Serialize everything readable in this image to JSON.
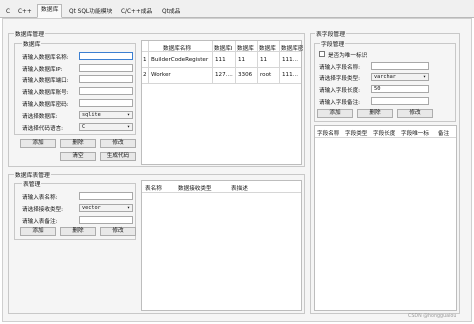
{
  "tabs": [
    {
      "label": "C"
    },
    {
      "label": "C++"
    },
    {
      "label": "数据库"
    },
    {
      "label": "Qt SQL功能模块"
    },
    {
      "label": "C/C++成品"
    },
    {
      "label": "Qt成品"
    }
  ],
  "db_manage": {
    "title": "数据库管理",
    "db_group_title": "数据库",
    "fields": [
      {
        "label": "请输入数据库名称:",
        "value": ""
      },
      {
        "label": "请输入数据库IP:",
        "value": ""
      },
      {
        "label": "请输入数据库端口:",
        "value": ""
      },
      {
        "label": "请输入数据库账号:",
        "value": ""
      },
      {
        "label": "请输入数据库密码:",
        "value": ""
      }
    ],
    "db_select_label": "请选择数据库:",
    "db_select_value": "sqlite",
    "lang_select_label": "请选择代码语言:",
    "lang_select_value": "C",
    "add_btn": "添加",
    "delete_btn": "删除",
    "modify_btn": "修改",
    "clear_btn": "清空",
    "gen_btn": "生成代码",
    "table": {
      "headers": [
        "数据库名称",
        "数据库I",
        "数据库",
        "数据库",
        "数据库密"
      ],
      "rows": [
        {
          "num": "1",
          "cells": [
            "BuilderCodeRegister",
            "111",
            "11",
            "11",
            "111..."
          ]
        },
        {
          "num": "2",
          "cells": [
            "Worker",
            "127....",
            "3306",
            "root",
            "111..."
          ]
        }
      ]
    }
  },
  "table_manage": {
    "title": "数据库表管理",
    "group_title": "表管理",
    "name_label": "请输入表名称:",
    "name_value": "",
    "type_label": "请选择接收类型:",
    "type_value": "vector",
    "note_label": "请输入表备注:",
    "note_value": "",
    "add_btn": "添加",
    "delete_btn": "删除",
    "modify_btn": "修改",
    "headers": [
      "表名称",
      "数据接收类型",
      "表描述"
    ]
  },
  "field_manage": {
    "title": "表字段管理",
    "group_title": "字段管理",
    "unique_label": "是否为唯一标识",
    "name_label": "请输入字段名称:",
    "name_value": "",
    "type_label": "请选择字段类型:",
    "type_value": "varchar",
    "length_label": "请输入字段长度:",
    "length_value": "50",
    "note_label": "请输入字段备注:",
    "note_value": "",
    "add_btn": "添加",
    "delete_btn": "删除",
    "modify_btn": "修改",
    "headers": [
      "字段名称",
      "字段类型",
      "字段长度",
      "字段唯一标",
      "备注"
    ]
  },
  "watermark": "CSDN @hongguaiou"
}
